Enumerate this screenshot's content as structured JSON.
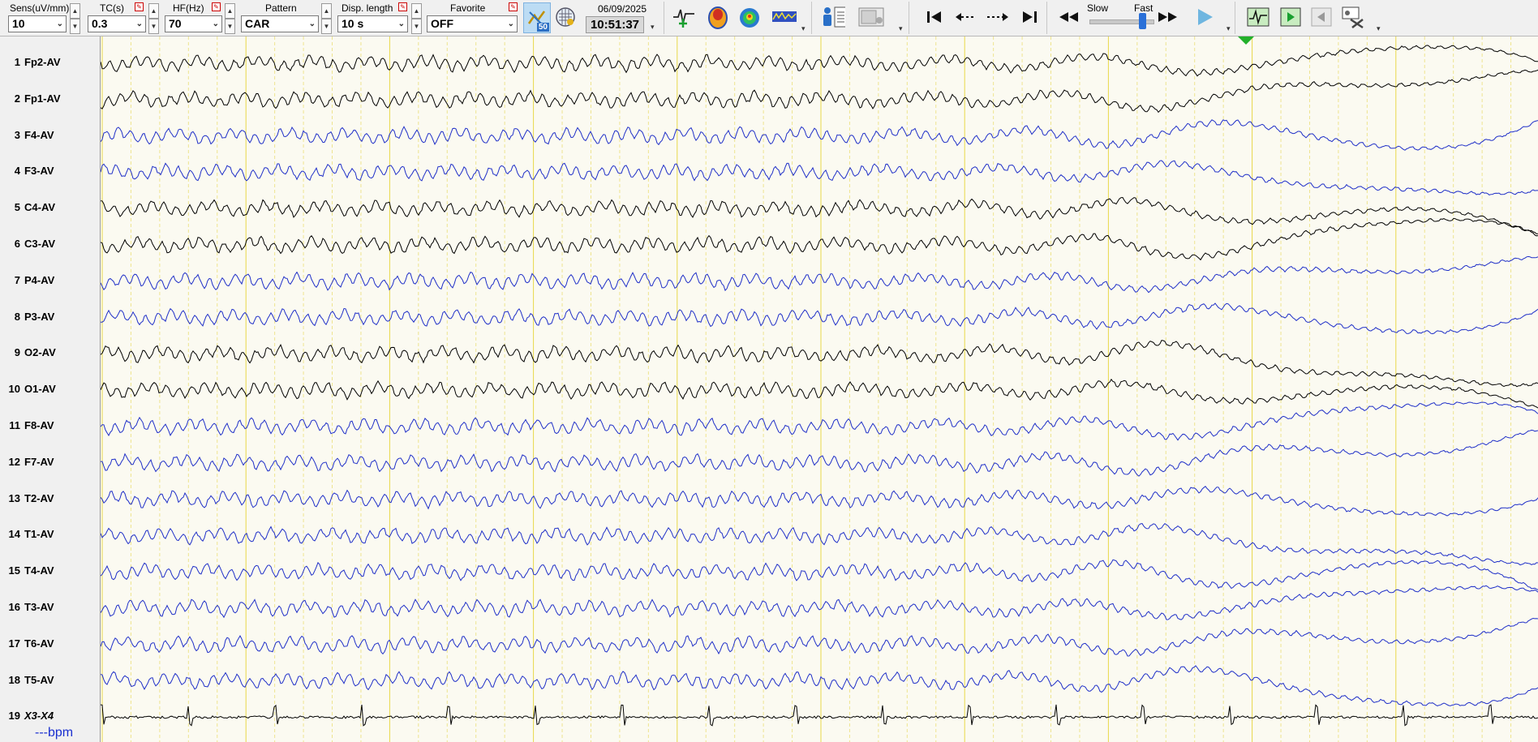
{
  "toolbar": {
    "sens": {
      "label": "Sens(uV/mm)",
      "value": "10"
    },
    "tc": {
      "label": "TC(s)",
      "value": "0.3"
    },
    "hf": {
      "label": "HF(Hz)",
      "value": "70"
    },
    "pattern": {
      "label": "Pattern",
      "value": "CAR"
    },
    "disp_length": {
      "label": "Disp. length",
      "value": "10 s"
    },
    "favorite": {
      "label": "Favorite",
      "value": "OFF"
    },
    "badge": "50",
    "date": "06/09/2025",
    "time": "10:51:37",
    "speed": {
      "slow_label": "Slow",
      "fast_label": "Fast",
      "level": 0.85
    },
    "icons": {
      "marker": "spike-marker-icon",
      "headmap": "head-topomap-icon",
      "spectral": "color-head-map-icon",
      "waveform": "spectrum-strip-icon",
      "person": "patient-info-icon",
      "video": "video-panel-icon",
      "first": "jump-first-icon",
      "back": "step-back-icon",
      "fwd": "step-forward-icon",
      "last": "jump-last-icon",
      "rewind": "rewind-icon",
      "ffwd": "fast-forward-icon",
      "play": "play-icon"
    }
  },
  "channels": [
    {
      "num": "1",
      "name": "Fp2-AV",
      "color": "#000000"
    },
    {
      "num": "2",
      "name": "Fp1-AV",
      "color": "#000000"
    },
    {
      "num": "3",
      "name": "F4-AV",
      "color": "#1f2fc8"
    },
    {
      "num": "4",
      "name": "F3-AV",
      "color": "#1f2fc8"
    },
    {
      "num": "5",
      "name": "C4-AV",
      "color": "#000000"
    },
    {
      "num": "6",
      "name": "C3-AV",
      "color": "#000000"
    },
    {
      "num": "7",
      "name": "P4-AV",
      "color": "#1f2fc8"
    },
    {
      "num": "8",
      "name": "P3-AV",
      "color": "#1f2fc8"
    },
    {
      "num": "9",
      "name": "O2-AV",
      "color": "#000000"
    },
    {
      "num": "10",
      "name": "O1-AV",
      "color": "#000000"
    },
    {
      "num": "11",
      "name": "F8-AV",
      "color": "#1f2fc8"
    },
    {
      "num": "12",
      "name": "F7-AV",
      "color": "#1f2fc8"
    },
    {
      "num": "13",
      "name": "T2-AV",
      "color": "#1f2fc8"
    },
    {
      "num": "14",
      "name": "T1-AV",
      "color": "#1f2fc8"
    },
    {
      "num": "15",
      "name": "T4-AV",
      "color": "#1f2fc8"
    },
    {
      "num": "16",
      "name": "T3-AV",
      "color": "#1f2fc8"
    },
    {
      "num": "17",
      "name": "T6-AV",
      "color": "#1f2fc8"
    },
    {
      "num": "18",
      "name": "T5-AV",
      "color": "#1f2fc8"
    },
    {
      "num": "19",
      "name": "X3-X4",
      "color": "#000000"
    }
  ],
  "heart_rate": "---bpm",
  "colors": {
    "background": "#fbfaf1",
    "grid_major": "#e8d84a",
    "grid_minor": "#eee48f",
    "cursor": "#22b02a"
  }
}
